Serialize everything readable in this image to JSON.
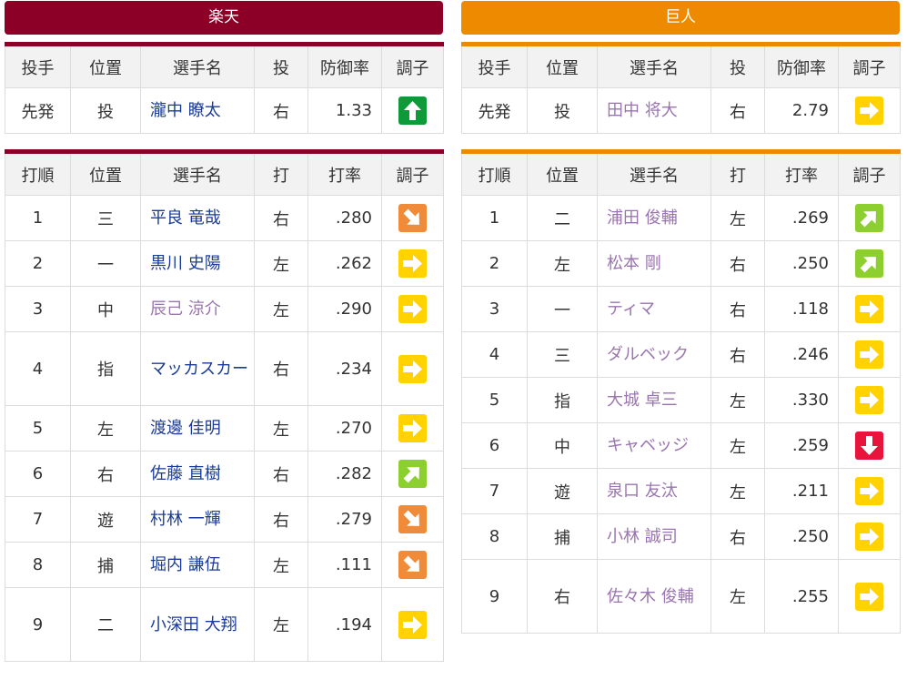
{
  "rakuten": {
    "team_name": "楽天",
    "pitcher_headers": [
      "投手",
      "位置",
      "選手名",
      "投",
      "防御率",
      "調子"
    ],
    "pitcher": {
      "role": "先発",
      "pos": "投",
      "name": "瀧中 瞭太",
      "hand": "右",
      "era": "1.33",
      "cond": "up"
    },
    "batter_headers": [
      "打順",
      "位置",
      "選手名",
      "打",
      "打率",
      "調子"
    ],
    "batters": [
      {
        "order": "1",
        "pos": "三",
        "name": "平良 竜哉",
        "hand": "右",
        "avg": ".280",
        "cond": "down-right"
      },
      {
        "order": "2",
        "pos": "一",
        "name": "黒川 史陽",
        "hand": "左",
        "avg": ".262",
        "cond": "right"
      },
      {
        "order": "3",
        "pos": "中",
        "name": "辰己 涼介",
        "hand": "左",
        "avg": ".290",
        "cond": "right"
      },
      {
        "order": "4",
        "pos": "指",
        "name": "マッカスカー",
        "hand": "右",
        "avg": ".234",
        "cond": "right"
      },
      {
        "order": "5",
        "pos": "左",
        "name": "渡邊 佳明",
        "hand": "左",
        "avg": ".270",
        "cond": "right"
      },
      {
        "order": "6",
        "pos": "右",
        "name": "佐藤 直樹",
        "hand": "右",
        "avg": ".282",
        "cond": "up-right"
      },
      {
        "order": "7",
        "pos": "遊",
        "name": "村林 一輝",
        "hand": "右",
        "avg": ".279",
        "cond": "down-right"
      },
      {
        "order": "8",
        "pos": "捕",
        "name": "堀内 謙伍",
        "hand": "左",
        "avg": ".111",
        "cond": "down-right"
      },
      {
        "order": "9",
        "pos": "二",
        "name": "小深田 大翔",
        "hand": "左",
        "avg": ".194",
        "cond": "right"
      }
    ]
  },
  "giants": {
    "team_name": "巨人",
    "pitcher_headers": [
      "投手",
      "位置",
      "選手名",
      "投",
      "防御率",
      "調子"
    ],
    "pitcher": {
      "role": "先発",
      "pos": "投",
      "name": "田中 将大",
      "hand": "右",
      "era": "2.79",
      "cond": "right"
    },
    "batter_headers": [
      "打順",
      "位置",
      "選手名",
      "打",
      "打率",
      "調子"
    ],
    "batters": [
      {
        "order": "1",
        "pos": "二",
        "name": "浦田 俊輔",
        "hand": "左",
        "avg": ".269",
        "cond": "up-right"
      },
      {
        "order": "2",
        "pos": "左",
        "name": "松本 剛",
        "hand": "右",
        "avg": ".250",
        "cond": "up-right"
      },
      {
        "order": "3",
        "pos": "一",
        "name": "ティマ",
        "hand": "右",
        "avg": ".118",
        "cond": "right"
      },
      {
        "order": "4",
        "pos": "三",
        "name": "ダルベック",
        "hand": "右",
        "avg": ".246",
        "cond": "right"
      },
      {
        "order": "5",
        "pos": "指",
        "name": "大城 卓三",
        "hand": "左",
        "avg": ".330",
        "cond": "right"
      },
      {
        "order": "6",
        "pos": "中",
        "name": "キャベッジ",
        "hand": "左",
        "avg": ".259",
        "cond": "down"
      },
      {
        "order": "7",
        "pos": "遊",
        "name": "泉口 友汰",
        "hand": "左",
        "avg": ".211",
        "cond": "right"
      },
      {
        "order": "8",
        "pos": "捕",
        "name": "小林 誠司",
        "hand": "右",
        "avg": ".250",
        "cond": "right"
      },
      {
        "order": "9",
        "pos": "右",
        "name": "佐々木 俊輔",
        "hand": "左",
        "avg": ".255",
        "cond": "right"
      }
    ]
  },
  "colors": {
    "rakuten": "#8c0028",
    "giants": "#ee8a00",
    "link_unvisited": "#1a3b97",
    "link_visited": "#9a74b0"
  },
  "condition_icons": {
    "up": "up-arrow-icon",
    "up-right": "up-right-arrow-icon",
    "right": "right-arrow-icon",
    "down-right": "down-right-arrow-icon",
    "down": "down-arrow-icon"
  }
}
